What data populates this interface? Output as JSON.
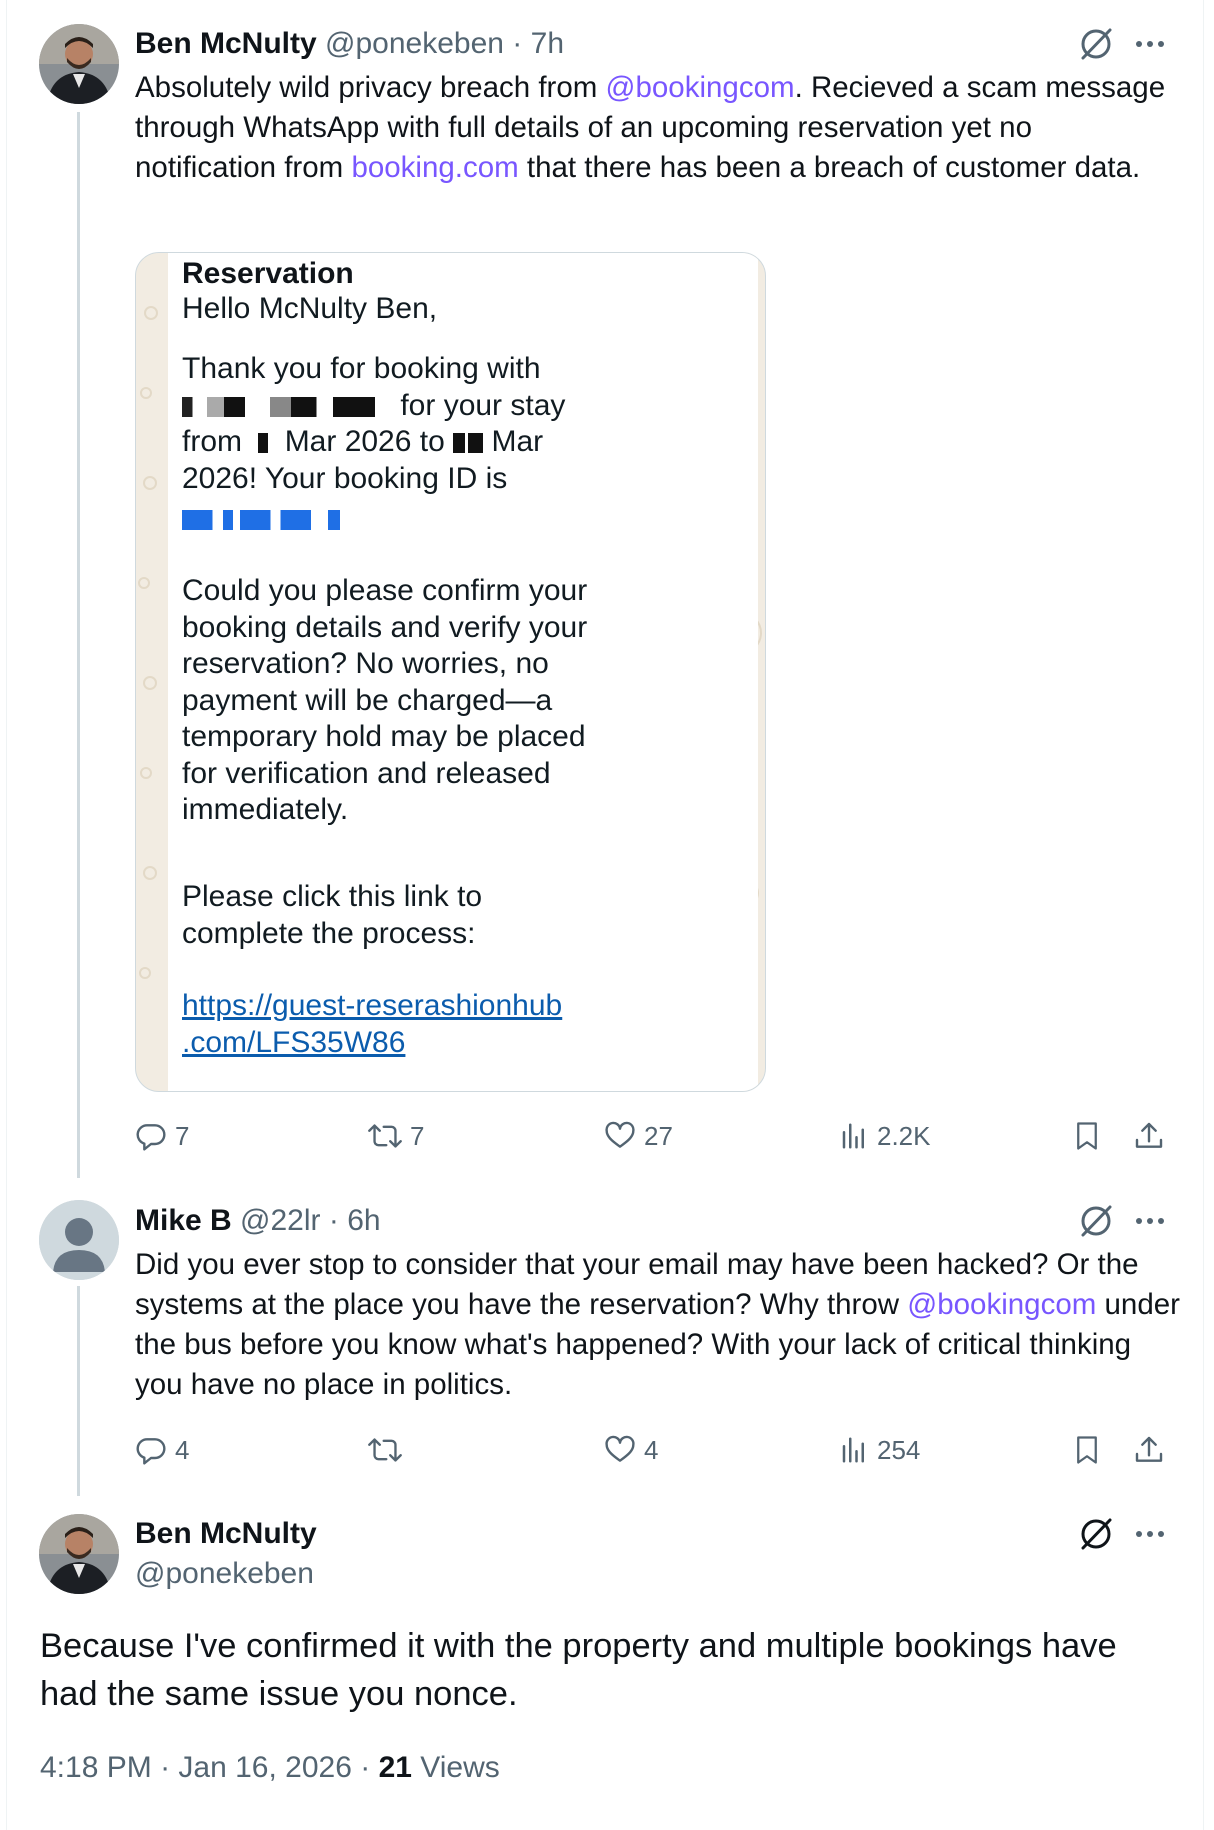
{
  "colors": {
    "link": "#7856ff",
    "muted": "#536471",
    "text": "#0f1419",
    "border": "#cfd9de"
  },
  "tweet1": {
    "name": "Ben McNulty",
    "handle": "@ponekeben",
    "time": "7h",
    "text_parts": [
      "Absolutely wild privacy breach from ",
      "@bookingcom",
      ". Recieved a scam message through WhatsApp with full details of an upcoming reservation yet no notification from ",
      "booking.com",
      " that there has been a breach of customer data."
    ],
    "media": {
      "title": "Reservation",
      "greeting": "Hello McNulty Ben,",
      "line1": "Thank you for booking with",
      "line2_end": "for your stay",
      "line3_from": "from",
      "line3_mid": "Mar 2026 to",
      "line3_end": "Mar",
      "line4": "2026! Your booking ID is",
      "para2": [
        "Could you please confirm your",
        "booking details and verify your",
        "reservation? No worries, no",
        "payment will be charged—a",
        "temporary hold may be placed",
        "for verification and released",
        "immediately."
      ],
      "para3": [
        "Please click this link to",
        "complete the process:"
      ],
      "url": [
        "https://guest-reserashionhub",
        ".com/LFS35W86"
      ]
    },
    "stats": {
      "replies": "7",
      "reposts": "7",
      "likes": "27",
      "views": "2.2K"
    }
  },
  "tweet2": {
    "name": "Mike B",
    "handle": "@22lr",
    "time": "6h",
    "text_parts": [
      "Did you ever stop to consider that your email may have been hacked?  Or the systems at the place you have the reservation?  Why throw ",
      "@bookingcom",
      " under the bus before you know what's happened?  With your lack of critical thinking you have no place in politics."
    ],
    "stats": {
      "replies": "4",
      "reposts": "",
      "likes": "4",
      "views": "254"
    }
  },
  "tweet3": {
    "name": "Ben McNulty",
    "handle": "@ponekeben",
    "text": "Because I've confirmed it with the property and multiple bookings have had the same issue you nonce.",
    "time": "4:18 PM",
    "date": "Jan 16, 2026",
    "views_count": "21",
    "views_label": "Views"
  },
  "icons": [
    "grok-icon",
    "more-icon",
    "reply-icon",
    "repost-icon",
    "like-icon",
    "views-icon",
    "bookmark-icon",
    "share-icon"
  ]
}
